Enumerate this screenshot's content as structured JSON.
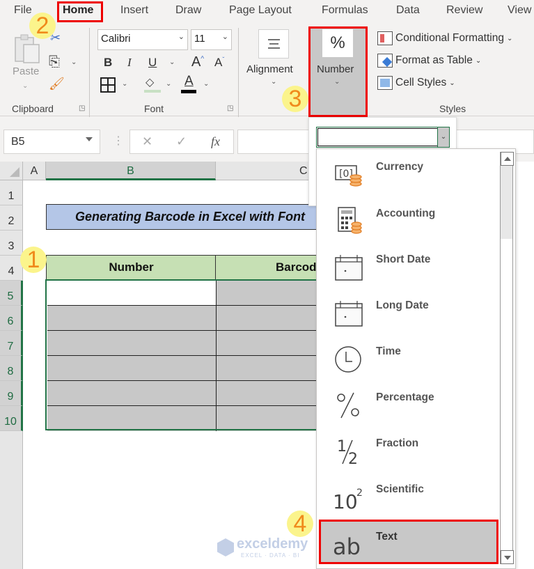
{
  "menu": {
    "tabs": [
      "File",
      "Home",
      "Insert",
      "Draw",
      "Page Layout",
      "Formulas",
      "Data",
      "Review",
      "View"
    ],
    "active_tab": "Home"
  },
  "ribbon": {
    "clipboard": {
      "paste_label": "Paste",
      "group_label": "Clipboard"
    },
    "font": {
      "font_name": "Calibri",
      "font_size": "11",
      "bold": "B",
      "italic": "I",
      "underline": "U",
      "grow": "A",
      "shrink": "A",
      "font_color": "A",
      "group_label": "Font"
    },
    "alignment": {
      "label": "Alignment"
    },
    "number": {
      "label": "Number",
      "icon_glyph": "%"
    },
    "styles": {
      "items": [
        "Conditional Formatting",
        "Format as Table",
        "Cell Styles"
      ],
      "group_label": "Styles"
    }
  },
  "formula_bar": {
    "name_box": "B5",
    "cancel_glyph": "✕",
    "enter_glyph": "✓",
    "fx_glyph": "fx",
    "formula_value": ""
  },
  "sheet": {
    "columns": [
      "A",
      "B",
      "C"
    ],
    "selected_column": "B",
    "rows": [
      "1",
      "2",
      "3",
      "4",
      "5",
      "6",
      "7",
      "8",
      "9",
      "10"
    ],
    "title": "Generating Barcode in Excel with Font",
    "table_headers": [
      "Number",
      "Barcode"
    ],
    "active_cell": "B5"
  },
  "number_format": {
    "current_value": "",
    "options": [
      {
        "label": "Currency",
        "icon": "currency-icon"
      },
      {
        "label": "Accounting",
        "icon": "accounting-icon"
      },
      {
        "label": "Short Date",
        "icon": "calendar-icon"
      },
      {
        "label": "Long Date",
        "icon": "calendar-icon"
      },
      {
        "label": "Time",
        "icon": "clock-icon"
      },
      {
        "label": "Percentage",
        "icon": "percent-icon"
      },
      {
        "label": "Fraction",
        "icon": "fraction-icon"
      },
      {
        "label": "Scientific",
        "icon": "scientific-icon"
      },
      {
        "label": "Text",
        "icon": "text-ab-icon"
      }
    ],
    "selected": "Text"
  },
  "steps": [
    "1",
    "2",
    "3",
    "4"
  ],
  "watermark": {
    "name": "exceldemy",
    "tagline": "EXCEL · DATA · BI"
  }
}
